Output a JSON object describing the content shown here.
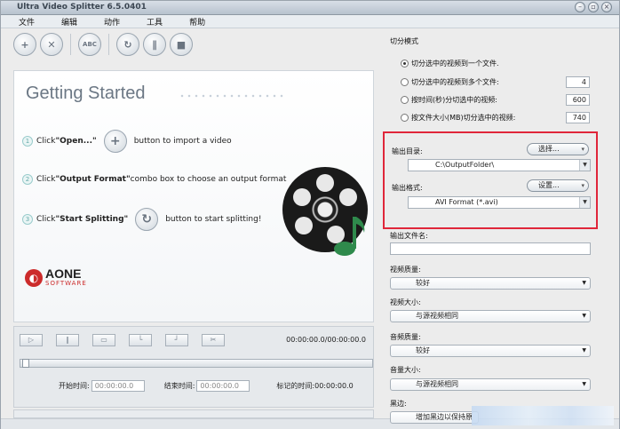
{
  "app": {
    "title": "Ultra Video Splitter 6.5.0401",
    "window_buttons": [
      "minimize-icon",
      "maximize-icon",
      "close-icon"
    ]
  },
  "menu": [
    "文件",
    "编辑",
    "动作",
    "工具",
    "帮助"
  ],
  "toolbar": {
    "buttons": [
      {
        "name": "add-icon",
        "glyph": "+"
      },
      {
        "name": "remove-icon",
        "glyph": "✕"
      },
      {
        "name": "abc-icon",
        "glyph": "ABC"
      },
      {
        "name": "refresh-icon",
        "glyph": "↻"
      },
      {
        "name": "pause-icon",
        "glyph": "∥"
      },
      {
        "name": "stop-icon",
        "glyph": "■"
      }
    ]
  },
  "banner": {
    "heading": "Getting Started",
    "step1_pre": "Click ",
    "step1_bold": "\"Open...\"",
    "step1_post": "button to import a video",
    "step2_pre": "Click ",
    "step2_bold": "\"Output Format\"",
    "step2_post": " combo box to choose an output format",
    "step3_pre": "Click ",
    "step3_bold": "\"Start Splitting\"",
    "step3_post": "button to start splitting!",
    "step_numbers": [
      "1",
      "2",
      "3"
    ],
    "logo_name": "AONE",
    "logo_sub": "SOFTWARE"
  },
  "player": {
    "time_display": "00:00:00.0/00:00:00.0",
    "start_label": "开始时间:",
    "start_value": "00:00:00.0",
    "end_label": "结束时间:",
    "end_value": "00:00:00.0",
    "marked_label": "标记的时间:",
    "marked_value": "00:00:00.0"
  },
  "split_mode": {
    "title": "切分模式",
    "options": [
      {
        "label": "切分选中的视频到一个文件.",
        "selected": true
      },
      {
        "label": "切分选中的视频到多个文件:",
        "selected": false,
        "value": "4"
      },
      {
        "label": "按时间(秒)分切选中的视频:",
        "selected": false,
        "value": "600"
      },
      {
        "label": "按文件大小(MB)切分选中的视频:",
        "selected": false,
        "value": "740"
      }
    ]
  },
  "output": {
    "dir_label": "输出目录:",
    "dir_button": "选择...",
    "dir_value": "C:\\OutputFolder\\",
    "format_label": "输出格式:",
    "format_button": "设置...",
    "format_value": "AVI Format (*.avi)",
    "filename_label": "输出文件名:",
    "filename_value": ""
  },
  "settings": {
    "video_quality_label": "视频质量:",
    "video_quality_value": "较好",
    "video_size_label": "视频大小:",
    "video_size_value": "与源视频相同",
    "audio_quality_label": "音频质量:",
    "audio_quality_value": "较好",
    "audio_size_label": "音量大小:",
    "audio_size_value": "与源视频相同",
    "border_label": "黑边:",
    "border_value": "增加黑边以保持原"
  },
  "colors": {
    "highlight_box": "#e0263a",
    "logo_red": "#cc2b2b"
  }
}
